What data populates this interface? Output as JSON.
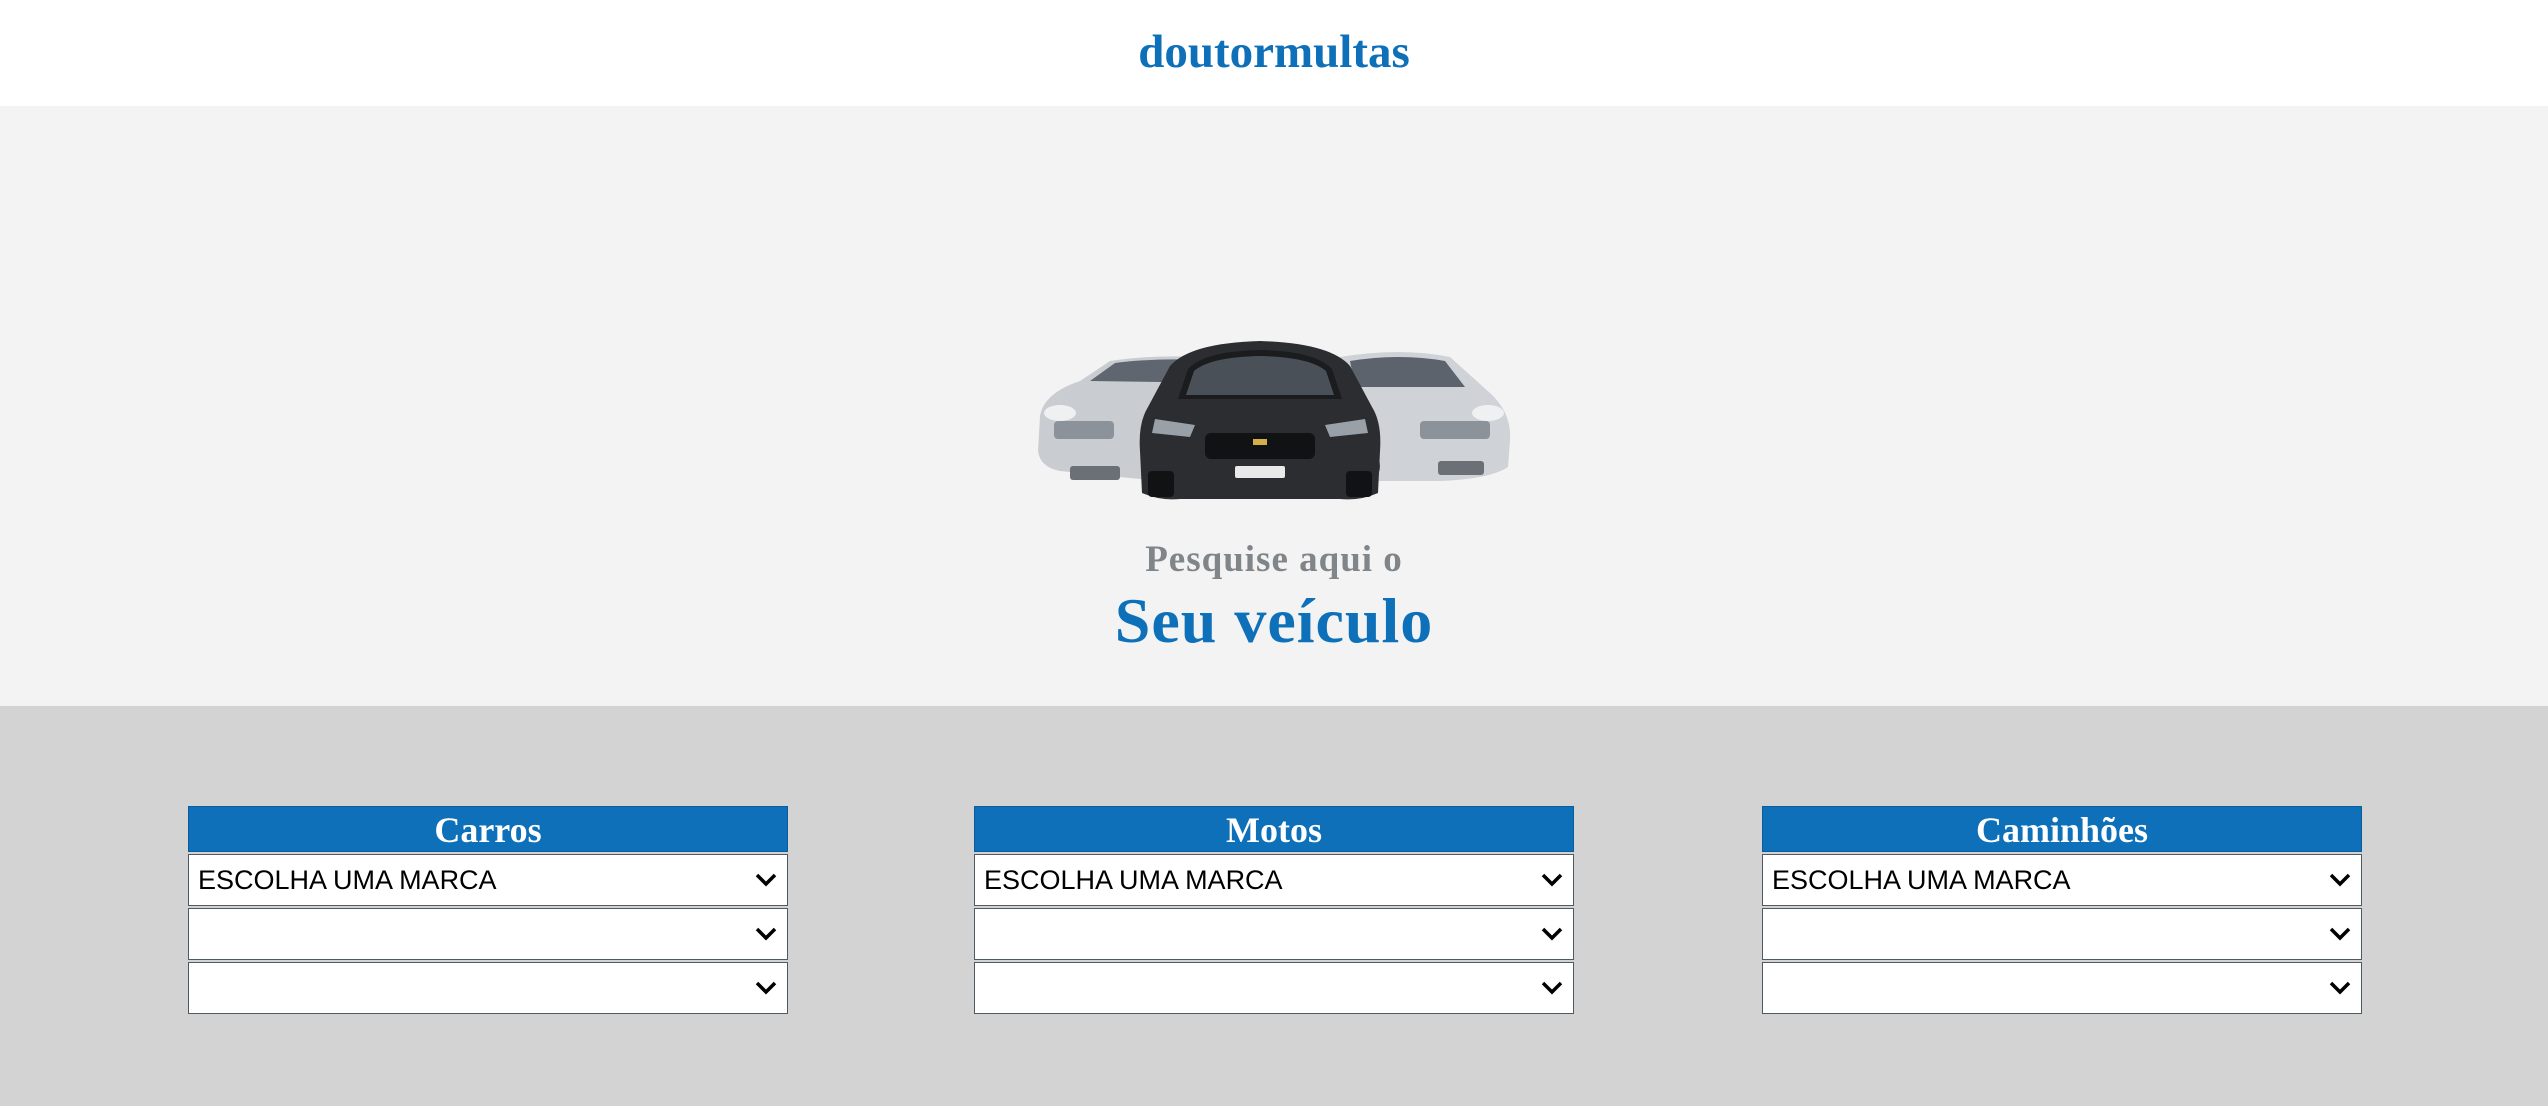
{
  "header": {
    "logo": "doutormultas"
  },
  "hero": {
    "image_icon": "cars-image",
    "subtitle": "Pesquise aqui o",
    "title": "Seu veículo"
  },
  "panels": [
    {
      "title": "Carros",
      "selects": [
        "ESCOLHA UMA MARCA",
        "",
        ""
      ]
    },
    {
      "title": "Motos",
      "selects": [
        "ESCOLHA UMA MARCA",
        "",
        ""
      ]
    },
    {
      "title": "Caminhões",
      "selects": [
        "ESCOLHA UMA MARCA",
        "",
        ""
      ]
    }
  ],
  "colors": {
    "brand": "#0d70b9",
    "hero_bg": "#f3f3f3",
    "panels_bg": "#d3d3d3",
    "subtitle": "#808589"
  }
}
